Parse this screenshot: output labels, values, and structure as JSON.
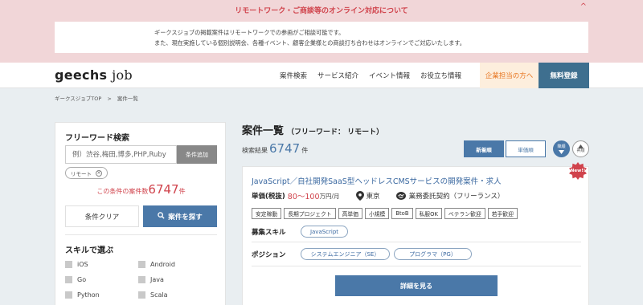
{
  "notice": {
    "title": "リモートワーク・ご商談等のオンライン対応について",
    "chevron": "^",
    "line1": "ギークスジョブの掲載案件はリモートワークでの参画がご相談可能です。",
    "line2": "また、現在実施している個別説明会、各種イベント、顧客企業様との商談打ち合わせはオンラインでご対応いたします。"
  },
  "header": {
    "logo_main": "geechs",
    "logo_sub": "job",
    "nav": [
      "案件検索",
      "サービス紹介",
      "イベント情報",
      "お役立ち情報"
    ],
    "corp_label": "企業担当の方へ",
    "register_label": "無料登録"
  },
  "breadcrumb": {
    "home": "ギークスジョブTOP",
    "sep": ">",
    "current": "案件一覧"
  },
  "search_panel": {
    "title": "フリーワード検索",
    "placeholder": "例）渋谷,梅田,博多,PHP,Ruby",
    "add_label": "条件追加",
    "chip_label": "リモート",
    "count_prefix": "この条件の案件数",
    "count": "6747",
    "count_suffix": "件",
    "clear_label": "条件クリア",
    "find_label": "案件を探す",
    "skill_title": "スキルで選ぶ",
    "skills": [
      "iOS",
      "Android",
      "Go",
      "Java",
      "Python",
      "Scala"
    ]
  },
  "main": {
    "title": "案件一覧",
    "subtitle": "（フリーワード： リモート）",
    "result_prefix": "検索結果",
    "result_count": "6747",
    "result_suffix": "件",
    "sort_new": "新着順",
    "sort_price": "単価順",
    "sort_desc": "降順",
    "sort_asc": "昇順"
  },
  "job": {
    "badge": "New!!",
    "title": "JavaScript／自社開発SaaS型ヘッドレスCMSサービスの開発案件・求人",
    "price_label": "単価(税抜)",
    "price": "80〜100",
    "price_unit": "万円/月",
    "location": "東京",
    "contract": "業務委託契約（フリーランス）",
    "tags": [
      "安定稼動",
      "長期プロジェクト",
      "高単価",
      "小規模",
      "BtoB",
      "私服OK",
      "ベテラン歓迎",
      "若手歓迎"
    ],
    "skill_label": "募集スキル",
    "skills": [
      "JavaScript"
    ],
    "position_label": "ポジション",
    "positions": [
      "システムエンジニア（SE）",
      "プログラマ（PG）"
    ],
    "detail_label": "詳細を見る"
  },
  "colors": {
    "accent": "#4a78a8",
    "alert": "#d0434c",
    "notice_bg": "#f1d6d8",
    "corp_bg": "#fdeedd",
    "register_bg": "#3e6f8f"
  }
}
